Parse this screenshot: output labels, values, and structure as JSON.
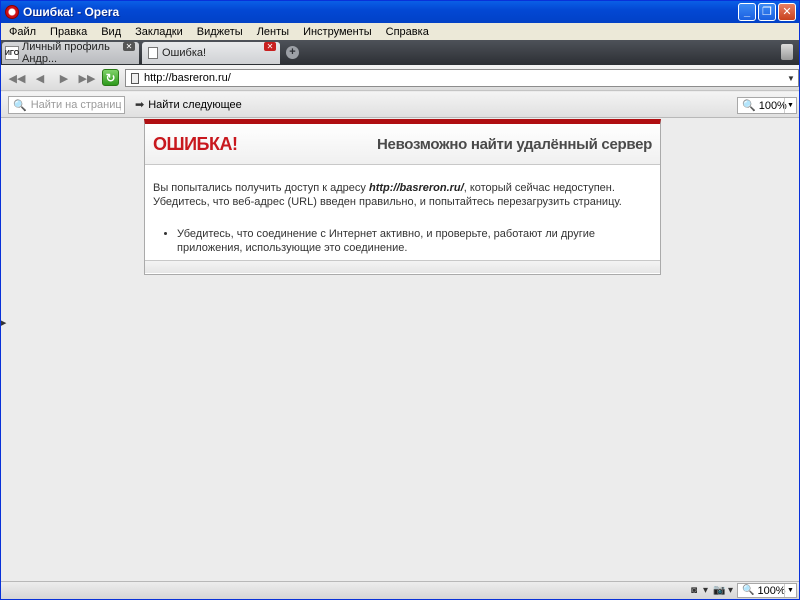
{
  "window": {
    "title": "Ошибка! - Opera"
  },
  "menu": {
    "items": [
      "Файл",
      "Правка",
      "Вид",
      "Закладки",
      "Виджеты",
      "Ленты",
      "Инструменты",
      "Справка"
    ]
  },
  "tabs": [
    {
      "label": "Личный профиль Андр...",
      "favicon_text": "ИГО",
      "active": false
    },
    {
      "label": "Ошибка!",
      "active": true
    }
  ],
  "address": {
    "url": "http://basreron.ru/"
  },
  "find": {
    "placeholder": "Найти на странице",
    "next_label": "Найти следующее"
  },
  "zoom": {
    "value": "100%"
  },
  "error_page": {
    "label": "ОШИБКА!",
    "heading": "Невозможно найти удалённый сервер",
    "text_before": "Вы попытались получить доступ к адресу ",
    "url": "http://basreron.ru/",
    "text_after": ", который сейчас недоступен. Убедитесь, что веб-адрес (URL) введен правильно, и попытайтесь перезагрузить страницу.",
    "bullets": [
      "Убедитесь, что соединение с Интернет активно, и проверьте, работают ли другие приложения, использующие это соединение."
    ]
  },
  "status": {
    "zoom": "100%"
  },
  "colors": {
    "error_red": "#c8181e",
    "titlebar_blue": "#0348d4",
    "reload_green": "#2f9a1d"
  }
}
